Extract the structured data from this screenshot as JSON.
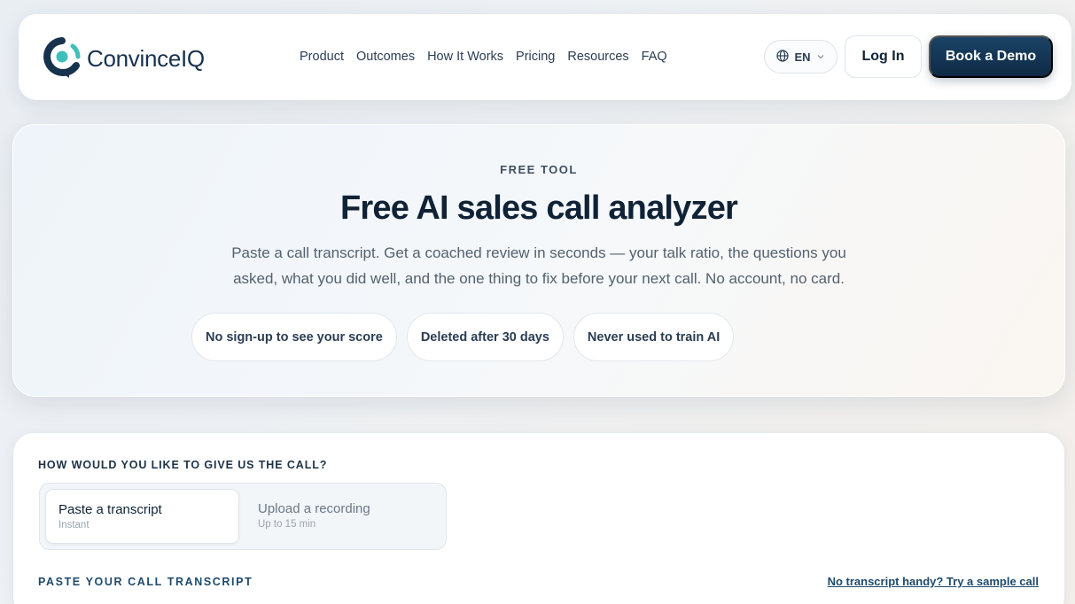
{
  "brand": {
    "name": "ConvinceIQ",
    "primary": "#0f2236",
    "accent": "#1e4a6b",
    "teal": "#3fbfba"
  },
  "nav": {
    "items": [
      {
        "label": "Product"
      },
      {
        "label": "Outcomes"
      },
      {
        "label": "How It Works"
      },
      {
        "label": "Pricing"
      },
      {
        "label": "Resources"
      },
      {
        "label": "FAQ"
      }
    ],
    "language": "EN",
    "login_label": "Log In",
    "demo_label": "Book a Demo"
  },
  "hero": {
    "eyebrow": "FREE TOOL",
    "title": "Free AI sales call analyzer",
    "subtitle_line1": "Paste a call transcript. Get a coached review in seconds — your talk ratio, the questions you",
    "subtitle_line2": "asked, what you did well, and the one thing to fix before your next call. No account, no card.",
    "badges": [
      {
        "label": "No sign-up to see your score"
      },
      {
        "label": "Deleted after 30 days"
      },
      {
        "label": "Never used to train AI"
      }
    ]
  },
  "form": {
    "question": "HOW WOULD YOU LIKE TO GIVE US THE CALL?",
    "options": [
      {
        "title": "Paste a transcript",
        "subtitle": "Instant",
        "selected": true
      },
      {
        "title": "Upload a recording",
        "subtitle": "Up to 15 min",
        "selected": false
      }
    ],
    "paste_label": "PASTE YOUR CALL TRANSCRIPT",
    "sample_link": "No transcript handy? Try a sample call"
  }
}
